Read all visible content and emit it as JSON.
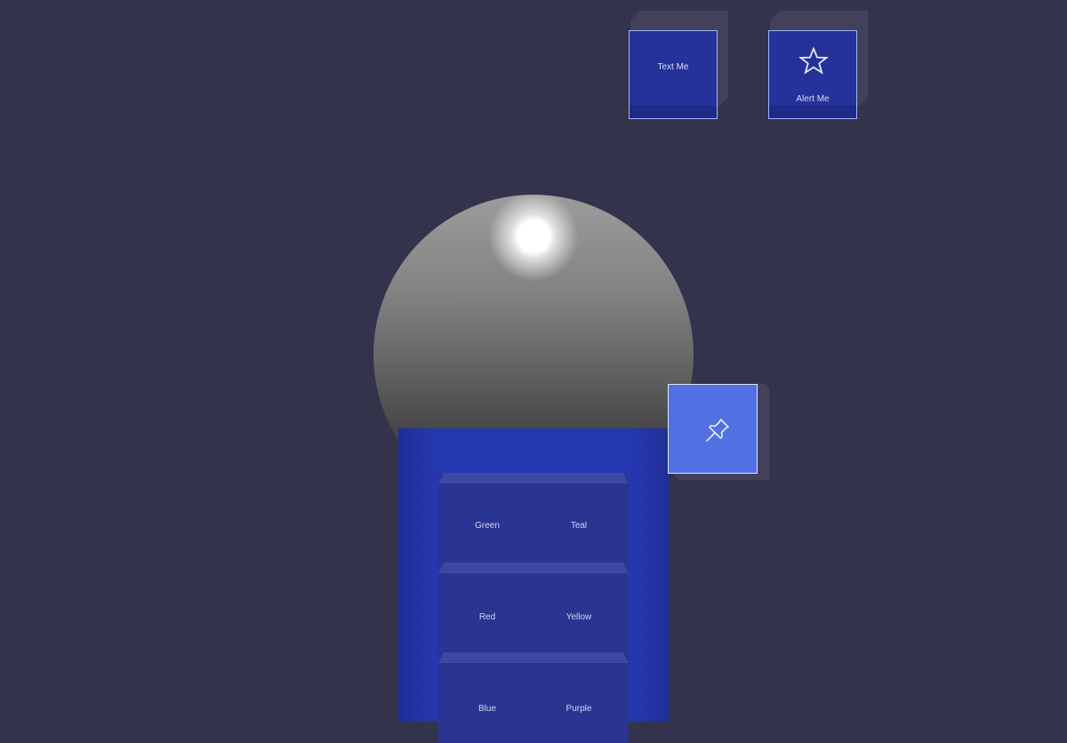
{
  "buttons": {
    "text_me": {
      "label": "Text Me",
      "icon": "none"
    },
    "alert_me": {
      "label": "Alert Me",
      "icon": "star-icon"
    },
    "pin": {
      "icon": "pin-icon"
    }
  },
  "menu": {
    "rows": [
      {
        "left": "Green",
        "right": "Teal"
      },
      {
        "left": "Red",
        "right": "Yellow"
      },
      {
        "left": "Blue",
        "right": "Purple"
      }
    ]
  },
  "colors": {
    "background": "#34334c",
    "button_face": "#24329a",
    "panel": "#2537ae",
    "pin_face": "#5171e3"
  }
}
